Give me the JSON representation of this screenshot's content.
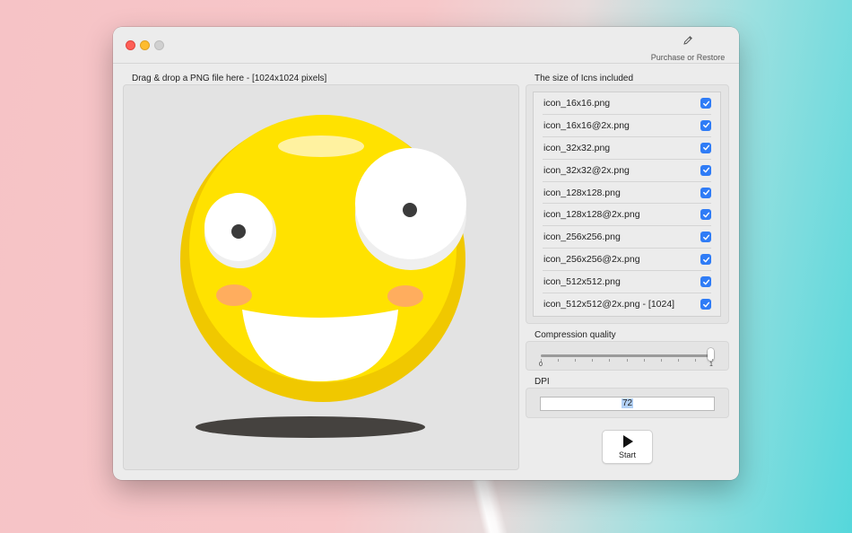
{
  "titlebar": {
    "purchase_label": "Purchase or Restore",
    "purchase_icon": "pencil-icon"
  },
  "drop_zone": {
    "label": "Drag & drop a PNG file here - [1024x1024 pixels]",
    "preview_icon": "smiley-face-image"
  },
  "icns": {
    "label": "The size of Icns included",
    "files": [
      {
        "name": "icon_16x16.png",
        "checked": true
      },
      {
        "name": "icon_16x16@2x.png",
        "checked": true
      },
      {
        "name": "icon_32x32.png",
        "checked": true
      },
      {
        "name": "icon_32x32@2x.png",
        "checked": true
      },
      {
        "name": "icon_128x128.png",
        "checked": true
      },
      {
        "name": "icon_128x128@2x.png",
        "checked": true
      },
      {
        "name": "icon_256x256.png",
        "checked": true
      },
      {
        "name": "icon_256x256@2x.png",
        "checked": true
      },
      {
        "name": "icon_512x512.png",
        "checked": true
      },
      {
        "name": "icon_512x512@2x.png - [1024]",
        "checked": true
      }
    ]
  },
  "compression": {
    "label": "Compression quality",
    "min_label": "0",
    "max_label": "1",
    "value": 1.0
  },
  "dpi": {
    "label": "DPI",
    "value": "72"
  },
  "start": {
    "label": "Start",
    "icon": "play-icon"
  },
  "colors": {
    "checkbox": "#2f7cf6",
    "close": "#fe5f57",
    "minimize": "#febc2e"
  }
}
